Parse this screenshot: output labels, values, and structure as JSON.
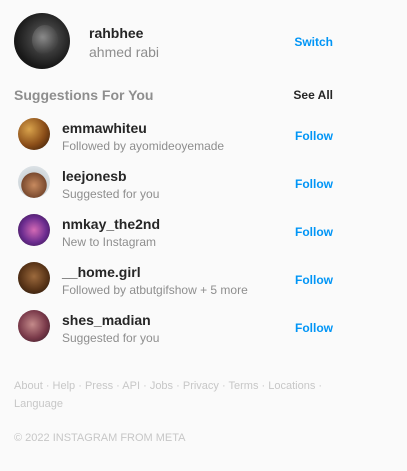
{
  "profile": {
    "username": "rahbhee",
    "name": "ahmed rabi",
    "switch_label": "Switch"
  },
  "suggestions": {
    "title": "Suggestions For You",
    "see_all_label": "See All",
    "items": [
      {
        "username": "emmawhiteu",
        "subtitle": "Followed by ayomideoyemade",
        "follow_label": "Follow"
      },
      {
        "username": "leejonesb",
        "subtitle": "Suggested for you",
        "follow_label": "Follow"
      },
      {
        "username": "nmkay_the2nd",
        "subtitle": "New to Instagram",
        "follow_label": "Follow"
      },
      {
        "username": "__home.girl",
        "subtitle": "Followed by atbutgifshow + 5 more",
        "follow_label": "Follow"
      },
      {
        "username": "shes_madian",
        "subtitle": "Suggested for you",
        "follow_label": "Follow"
      }
    ]
  },
  "footer": {
    "links": [
      "About",
      "Help",
      "Press",
      "API",
      "Jobs",
      "Privacy",
      "Terms",
      "Locations",
      "Language"
    ],
    "separator": "·",
    "copyright": "© 2022 Instagram from Meta"
  },
  "colors": {
    "accent": "#0095f6",
    "muted": "#8e8e8e",
    "footer_text": "#c7c7c7",
    "background": "#fafafa"
  }
}
